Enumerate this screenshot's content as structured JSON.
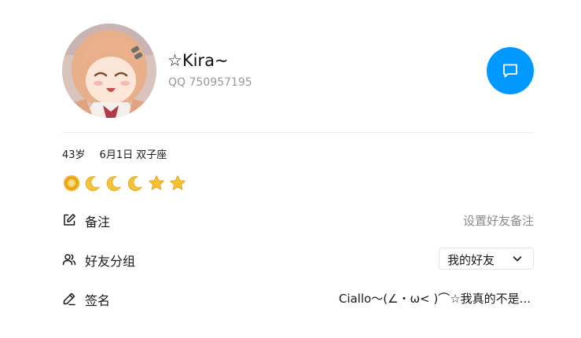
{
  "profile": {
    "nickname": "☆Kira~",
    "qq_label": "QQ 750957195",
    "avatar_icon": "anime-girl-avatar"
  },
  "actions": {
    "message_icon": "chat-bubble-icon",
    "accent_color": "#0099ff"
  },
  "info": {
    "age": "43岁",
    "birthday": "6月1日 双子座"
  },
  "level": {
    "badges": [
      "sun-icon",
      "moon-icon",
      "moon-icon",
      "moon-icon",
      "star-icon",
      "star-icon"
    ]
  },
  "remark": {
    "label": "备注",
    "value": "设置好友备注",
    "icon": "edit-note-icon"
  },
  "group": {
    "label": "好友分组",
    "selected": "我的好友",
    "icon": "users-icon"
  },
  "signature": {
    "label": "签名",
    "value": "Ciallo～(∠・ω< )⌒☆我真的不是...",
    "icon": "pencil-icon"
  }
}
